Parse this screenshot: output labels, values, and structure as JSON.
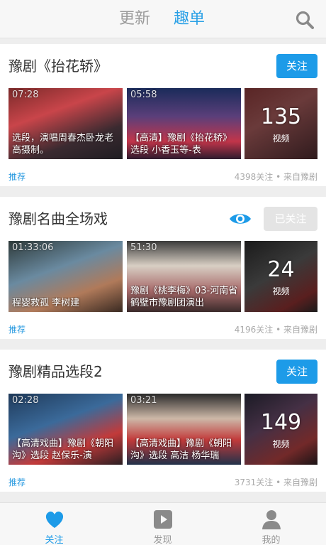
{
  "header": {
    "tab_updates": "更新",
    "tab_lists": "趣单"
  },
  "cards": [
    {
      "title": "豫剧《抬花轿》",
      "button": "关注",
      "videos": [
        {
          "duration": "07:28",
          "caption": "选段，演唱周春杰卧龙老高摄制。"
        },
        {
          "duration": "05:58",
          "caption": "【高清】豫剧《抬花轿》选段 小香玉等-表"
        }
      ],
      "video_count": "135",
      "video_unit": "视频",
      "tag": "推荐",
      "meta": "4398关注 • 来自豫剧"
    },
    {
      "title": "豫剧名曲全场戏",
      "button": "已关注",
      "videos": [
        {
          "duration": "01:33:06",
          "caption": "程婴救孤 李树建"
        },
        {
          "duration": "51:30",
          "caption": "豫剧《桃李梅》03-河南省鹤壁市豫剧团演出"
        }
      ],
      "video_count": "24",
      "video_unit": "视频",
      "tag": "推荐",
      "meta": "4196关注 • 来自豫剧"
    },
    {
      "title": "豫剧精品选段2",
      "button": "关注",
      "videos": [
        {
          "duration": "02:28",
          "caption": "【高清戏曲】豫剧《朝阳沟》选段 赵保乐-演"
        },
        {
          "duration": "03:21",
          "caption": "【高清戏曲】豫剧《朝阳沟》选段 高洁 杨华瑞"
        }
      ],
      "video_count": "149",
      "video_unit": "视频",
      "tag": "推荐",
      "meta": "3731关注 • 来自豫剧"
    }
  ],
  "bottom_nav": [
    {
      "label": "关注",
      "icon": "heart-icon",
      "active": true
    },
    {
      "label": "发现",
      "icon": "play-icon",
      "active": false
    },
    {
      "label": "我的",
      "icon": "user-icon",
      "active": false
    }
  ],
  "colors": {
    "accent": "#1d9be8",
    "followed_button": "#e4e4e4"
  }
}
